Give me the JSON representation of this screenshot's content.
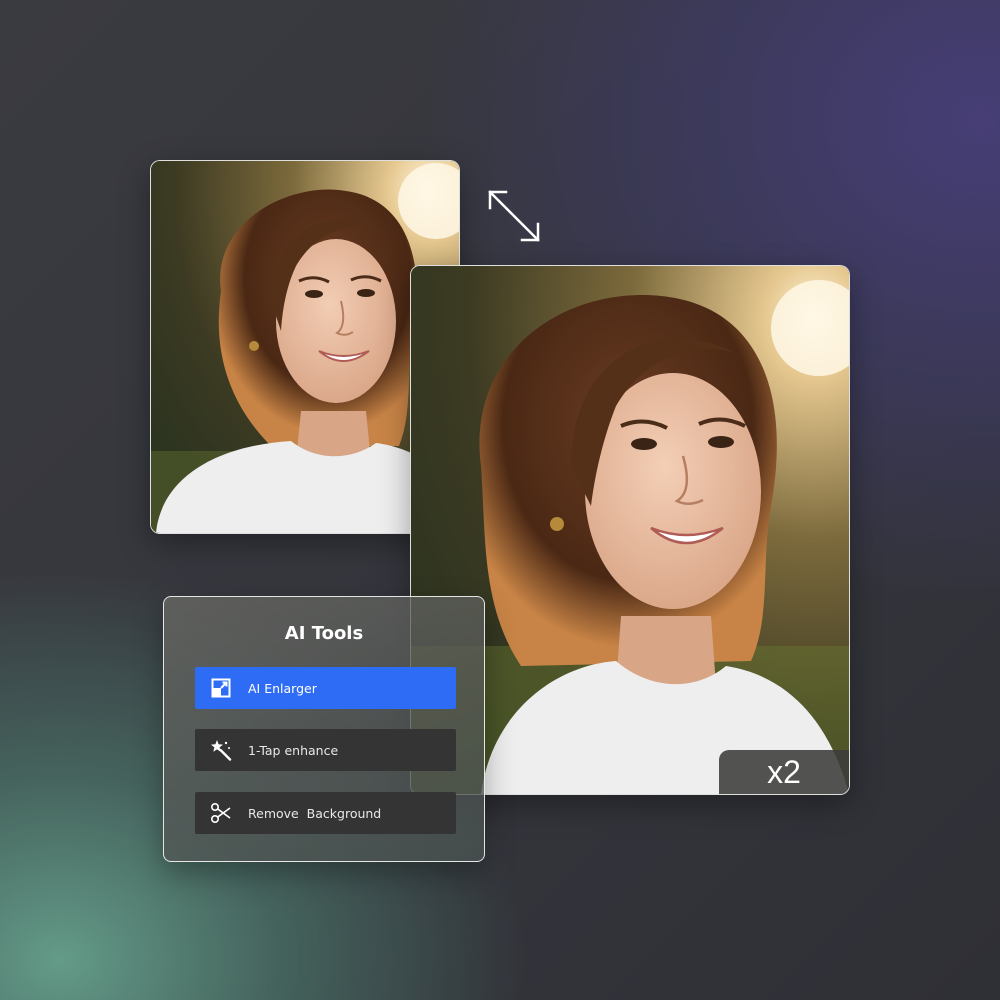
{
  "preview": {
    "scale_label": "x2"
  },
  "tools_panel": {
    "title": "AI Tools",
    "items": [
      {
        "label": "AI Enlarger",
        "icon": "enlarge-icon",
        "active": true
      },
      {
        "label": "1-Tap enhance",
        "icon": "magic-wand-icon",
        "active": false
      },
      {
        "label": "Remove  Background",
        "icon": "scissors-icon",
        "active": false
      }
    ]
  },
  "colors": {
    "accent": "#2f6cf5",
    "button_dark": "#343434",
    "text_light": "#ffffff"
  }
}
